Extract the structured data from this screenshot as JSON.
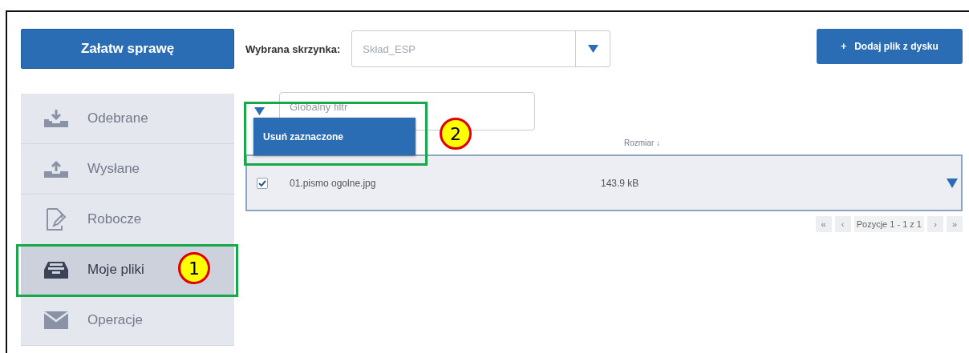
{
  "action_button": {
    "label": "Załatw sprawę"
  },
  "sidebar": {
    "items": [
      {
        "label": "Odebrane",
        "selected": false
      },
      {
        "label": "Wysłane",
        "selected": false
      },
      {
        "label": "Robocze",
        "selected": false
      },
      {
        "label": "Moje pliki",
        "selected": true
      },
      {
        "label": "Operacje",
        "selected": false
      }
    ]
  },
  "mailbox": {
    "label": "Wybrana skrzynka:",
    "value": "Skład_ESP"
  },
  "add_button": {
    "label": "Dodaj plik z dysku",
    "icon": "+"
  },
  "filter": {
    "placeholder": "Globalny filtr"
  },
  "bulk_menu": {
    "items": [
      {
        "label": "Usuń zaznaczone"
      }
    ]
  },
  "table": {
    "columns": [
      {
        "label": "Rozmiar ↓"
      }
    ],
    "rows": [
      {
        "name": "01.pismo ogolne.jpg",
        "size": "143.9 kB",
        "checked": true
      }
    ]
  },
  "pagination": {
    "first": "«",
    "prev": "‹",
    "info": "Pozycje 1 - 1 z 1",
    "next": "›",
    "last": "»"
  },
  "annotations": [
    {
      "label": "1"
    },
    {
      "label": "2"
    }
  ]
}
